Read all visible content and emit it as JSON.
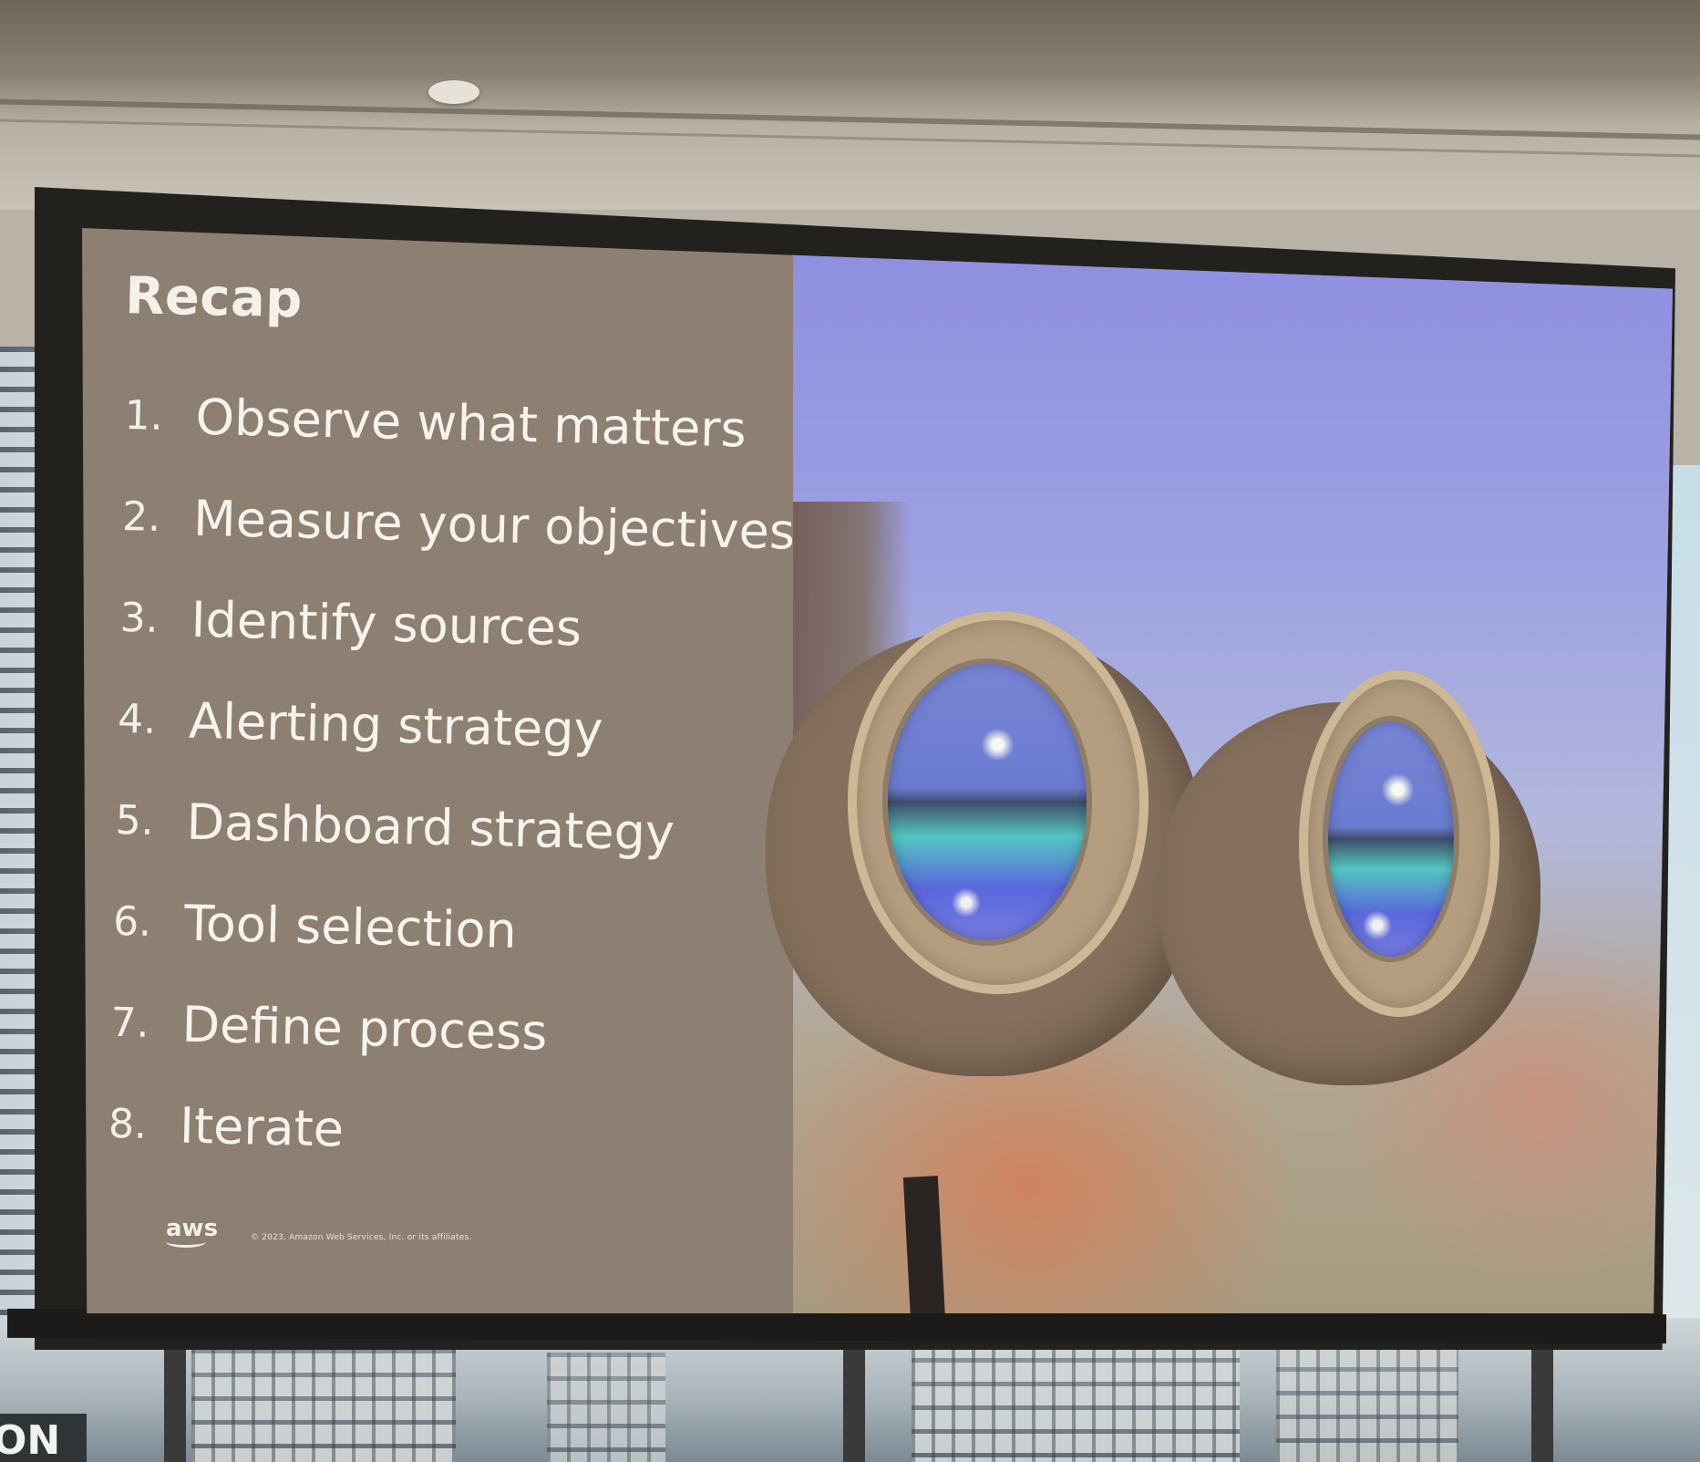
{
  "slide": {
    "title": "Recap",
    "items": [
      {
        "number": "1.",
        "text": "Observe what matters"
      },
      {
        "number": "2.",
        "text": "Measure your objectives"
      },
      {
        "number": "3.",
        "text": "Identify sources"
      },
      {
        "number": "4.",
        "text": "Alerting strategy"
      },
      {
        "number": "5.",
        "text": "Dashboard strategy"
      },
      {
        "number": "6.",
        "text": "Tool selection"
      },
      {
        "number": "7.",
        "text": "Define process"
      },
      {
        "number": "8.",
        "text": "Iterate"
      }
    ],
    "logo_text": "aws",
    "copyright": "© 2023, Amazon Web Services, Inc. or its affiliates."
  },
  "background_sign_text": "ON",
  "colors": {
    "slide_panel": "#8d7f71",
    "slide_text": "#f6f3ee",
    "photo_sky": "#9da0e2",
    "screen_bezel": "#23211e"
  }
}
